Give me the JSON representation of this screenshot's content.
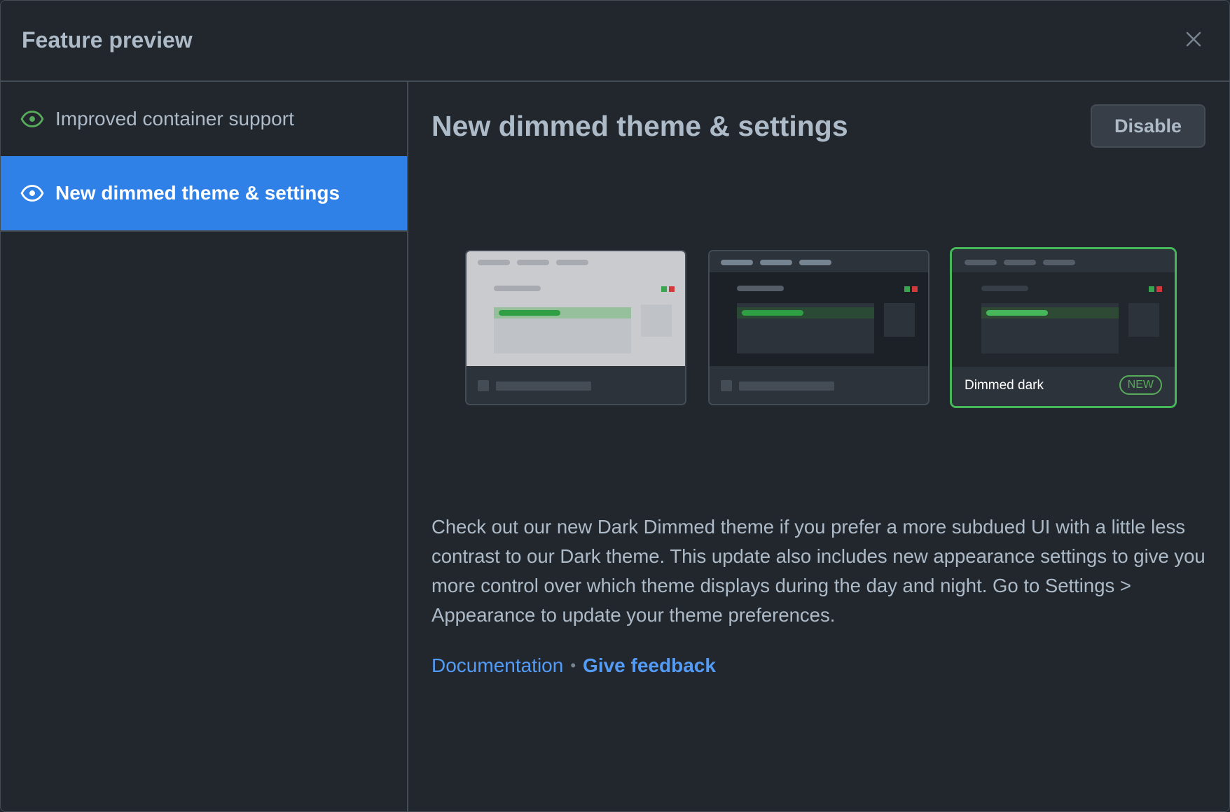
{
  "header": {
    "title": "Feature preview"
  },
  "sidebar": {
    "items": [
      {
        "label": "Improved container support",
        "active": false
      },
      {
        "label": "New dimmed theme & settings",
        "active": true
      }
    ]
  },
  "main": {
    "title": "New dimmed theme & settings",
    "disable_label": "Disable",
    "themes": [
      {
        "name": "Light",
        "label": ""
      },
      {
        "name": "Dark",
        "label": ""
      },
      {
        "name": "Dimmed dark",
        "label": "Dimmed dark",
        "badge": "NEW",
        "selected": true
      }
    ],
    "description": "Check out our new Dark Dimmed theme if you prefer a more subdued UI with a little less contrast to our Dark theme. This update also includes new appearance settings to give you more control over which theme displays during the day and night. Go to Settings > Appearance to update your theme preferences.",
    "links": {
      "documentation": "Documentation",
      "separator": "•",
      "feedback": "Give feedback"
    }
  },
  "colors": {
    "background": "#22272e",
    "border": "#444c56",
    "accent": "#2f81e7",
    "link": "#539bf5",
    "success": "#57ab5a",
    "text": "#adbac7"
  }
}
